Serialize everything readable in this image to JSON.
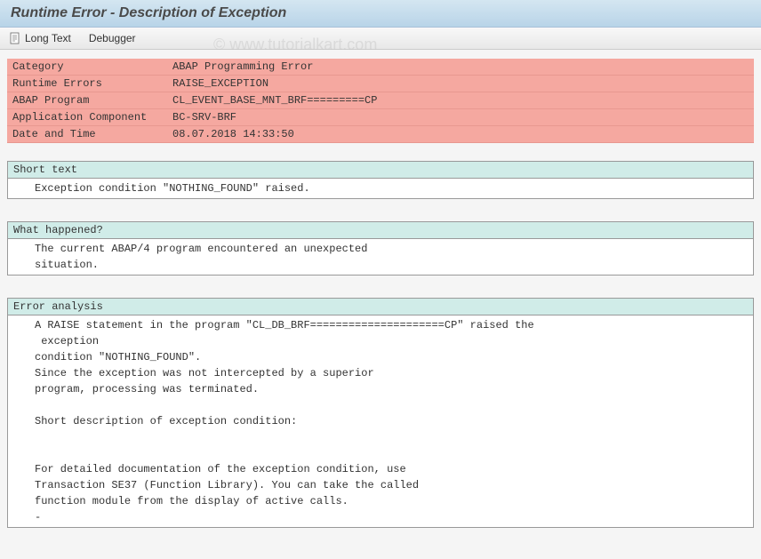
{
  "title": "Runtime Error - Description of Exception",
  "watermark": "© www.tutorialkart.com",
  "toolbar": {
    "long_text": "Long Text",
    "debugger": "Debugger"
  },
  "error_info": {
    "rows": [
      {
        "label": "Category",
        "value": "ABAP Programming Error"
      },
      {
        "label": "Runtime Errors",
        "value": "RAISE_EXCEPTION"
      },
      {
        "label": "ABAP Program",
        "value": "CL_EVENT_BASE_MNT_BRF=========CP"
      },
      {
        "label": "Application Component",
        "value": "BC-SRV-BRF"
      },
      {
        "label": "Date and Time",
        "value": "08.07.2018 14:33:50"
      }
    ]
  },
  "sections": [
    {
      "header": "Short text",
      "body": "Exception condition \"NOTHING_FOUND\" raised."
    },
    {
      "header": "What happened?",
      "body": "The current ABAP/4 program encountered an unexpected\nsituation."
    },
    {
      "header": "Error analysis",
      "body": "A RAISE statement in the program \"CL_DB_BRF=====================CP\" raised the\n exception\ncondition \"NOTHING_FOUND\".\nSince the exception was not intercepted by a superior\nprogram, processing was terminated.\n\nShort description of exception condition:\n\n\nFor detailed documentation of the exception condition, use\nTransaction SE37 (Function Library). You can take the called\nfunction module from the display of active calls.\n-"
    }
  ]
}
